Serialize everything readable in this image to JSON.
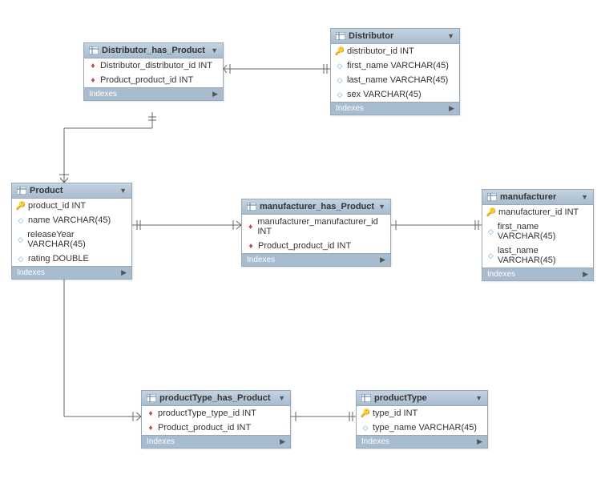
{
  "labels": {
    "indexes": "Indexes"
  },
  "entities": [
    {
      "name": "Distributor_has_Product",
      "columns": [
        "Distributor_distributor_id INT",
        "Product_product_id INT"
      ]
    },
    {
      "name": "Distributor",
      "columns": [
        "distributor_id INT",
        "first_name VARCHAR(45)",
        "last_name VARCHAR(45)",
        "sex VARCHAR(45)"
      ]
    },
    {
      "name": "Product",
      "columns": [
        "product_id INT",
        "name VARCHAR(45)",
        "releaseYear VARCHAR(45)",
        "rating DOUBLE"
      ]
    },
    {
      "name": "manufacturer_has_Product",
      "columns": [
        "manufacturer_manufacturer_id INT",
        "Product_product_id INT"
      ]
    },
    {
      "name": "manufacturer",
      "columns": [
        "manufacturer_id INT",
        "first_name VARCHAR(45)",
        "last_name VARCHAR(45)"
      ]
    },
    {
      "name": "productType_has_Product",
      "columns": [
        "productType_type_id INT",
        "Product_product_id INT"
      ]
    },
    {
      "name": "productType",
      "columns": [
        "type_id INT",
        "type_name VARCHAR(45)"
      ]
    }
  ],
  "relationships": [
    {
      "from": "Distributor_has_Product",
      "to": "Distributor",
      "type": "many-to-one"
    },
    {
      "from": "Distributor_has_Product",
      "to": "Product",
      "type": "many-to-one"
    },
    {
      "from": "manufacturer_has_Product",
      "to": "Product",
      "type": "many-to-one"
    },
    {
      "from": "manufacturer_has_Product",
      "to": "manufacturer",
      "type": "many-to-one"
    },
    {
      "from": "productType_has_Product",
      "to": "Product",
      "type": "many-to-one"
    },
    {
      "from": "productType_has_Product",
      "to": "productType",
      "type": "many-to-one"
    }
  ]
}
